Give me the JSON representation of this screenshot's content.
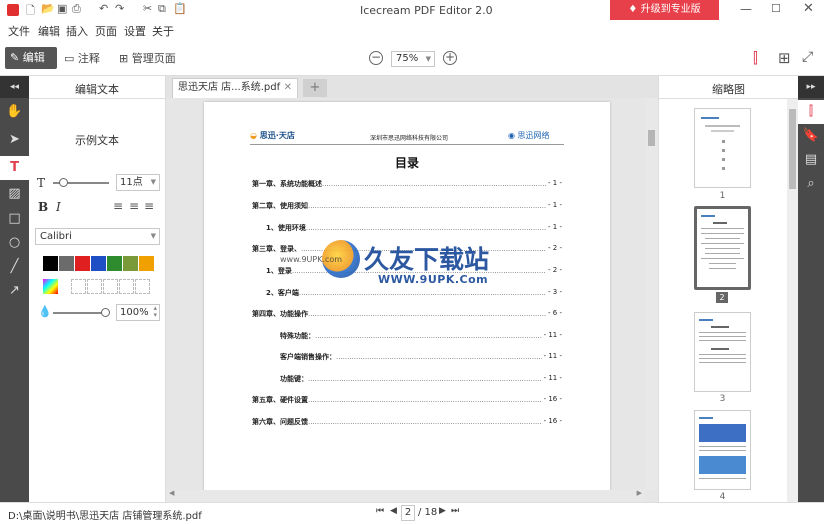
{
  "window": {
    "title": "Icecream PDF Editor 2.0",
    "upgrade_label": "升级到专业版"
  },
  "menu": [
    "文件",
    "编辑",
    "插入",
    "页面",
    "设置",
    "关于"
  ],
  "toolbar": {
    "edit_label": "编辑",
    "annotate_label": "注释",
    "manage_label": "管理页面",
    "zoom": "75%"
  },
  "leftpanel": {
    "title": "编辑文本",
    "sample_text": "示例文本",
    "font_size": "11点",
    "bold": "B",
    "italic": "I",
    "font_family": "Calibri",
    "opacity": "100%",
    "colors": [
      "#000000",
      "#6b6b6b",
      "#e02020",
      "#1e4fc4",
      "#2e8b2e",
      "#7a9a3a",
      "#f0a000"
    ]
  },
  "tab": {
    "name": "思迅天店 店...系统.pdf"
  },
  "document": {
    "header_logo_left": "思迅·天店",
    "header_company": "深圳市思迅网络科技有限公司",
    "header_logo_right": "思迅网络",
    "heading": "目录",
    "toc": [
      {
        "label": "第一章、系统功能概述",
        "page": "- 1 -"
      },
      {
        "label": "第二章、使用须知",
        "page": "- 1 -"
      },
      {
        "label": "1、使用环境",
        "page": "- 1 -"
      },
      {
        "label": "第三章、登录、",
        "page": "- 2 -"
      },
      {
        "label": "1、登录",
        "page": "- 2 -"
      },
      {
        "label": "2、客户端",
        "page": "- 3 -"
      },
      {
        "label": "第四章、功能操作",
        "page": "- 6 -"
      },
      {
        "label": "特殊功能：",
        "page": "- 11 -"
      },
      {
        "label": "客户端销售操作：",
        "page": "- 11 -"
      },
      {
        "label": "功能键：",
        "page": "- 11 -"
      },
      {
        "label": "第五章、硬件设置",
        "page": "- 16 -"
      },
      {
        "label": "第六章、问题反馈",
        "page": "- 16 -"
      }
    ],
    "watermark_main": "久友下载站",
    "watermark_url": "WWW.9UPK.Com",
    "watermark_small": "www.9UPK.com"
  },
  "thumbs": {
    "title": "缩略图",
    "pages": [
      "1",
      "2",
      "3",
      "4"
    ]
  },
  "status": {
    "path": "D:\\桌面\\说明书\\思迅天店 店铺管理系统.pdf",
    "current_page": "2",
    "total": "/ 18"
  }
}
